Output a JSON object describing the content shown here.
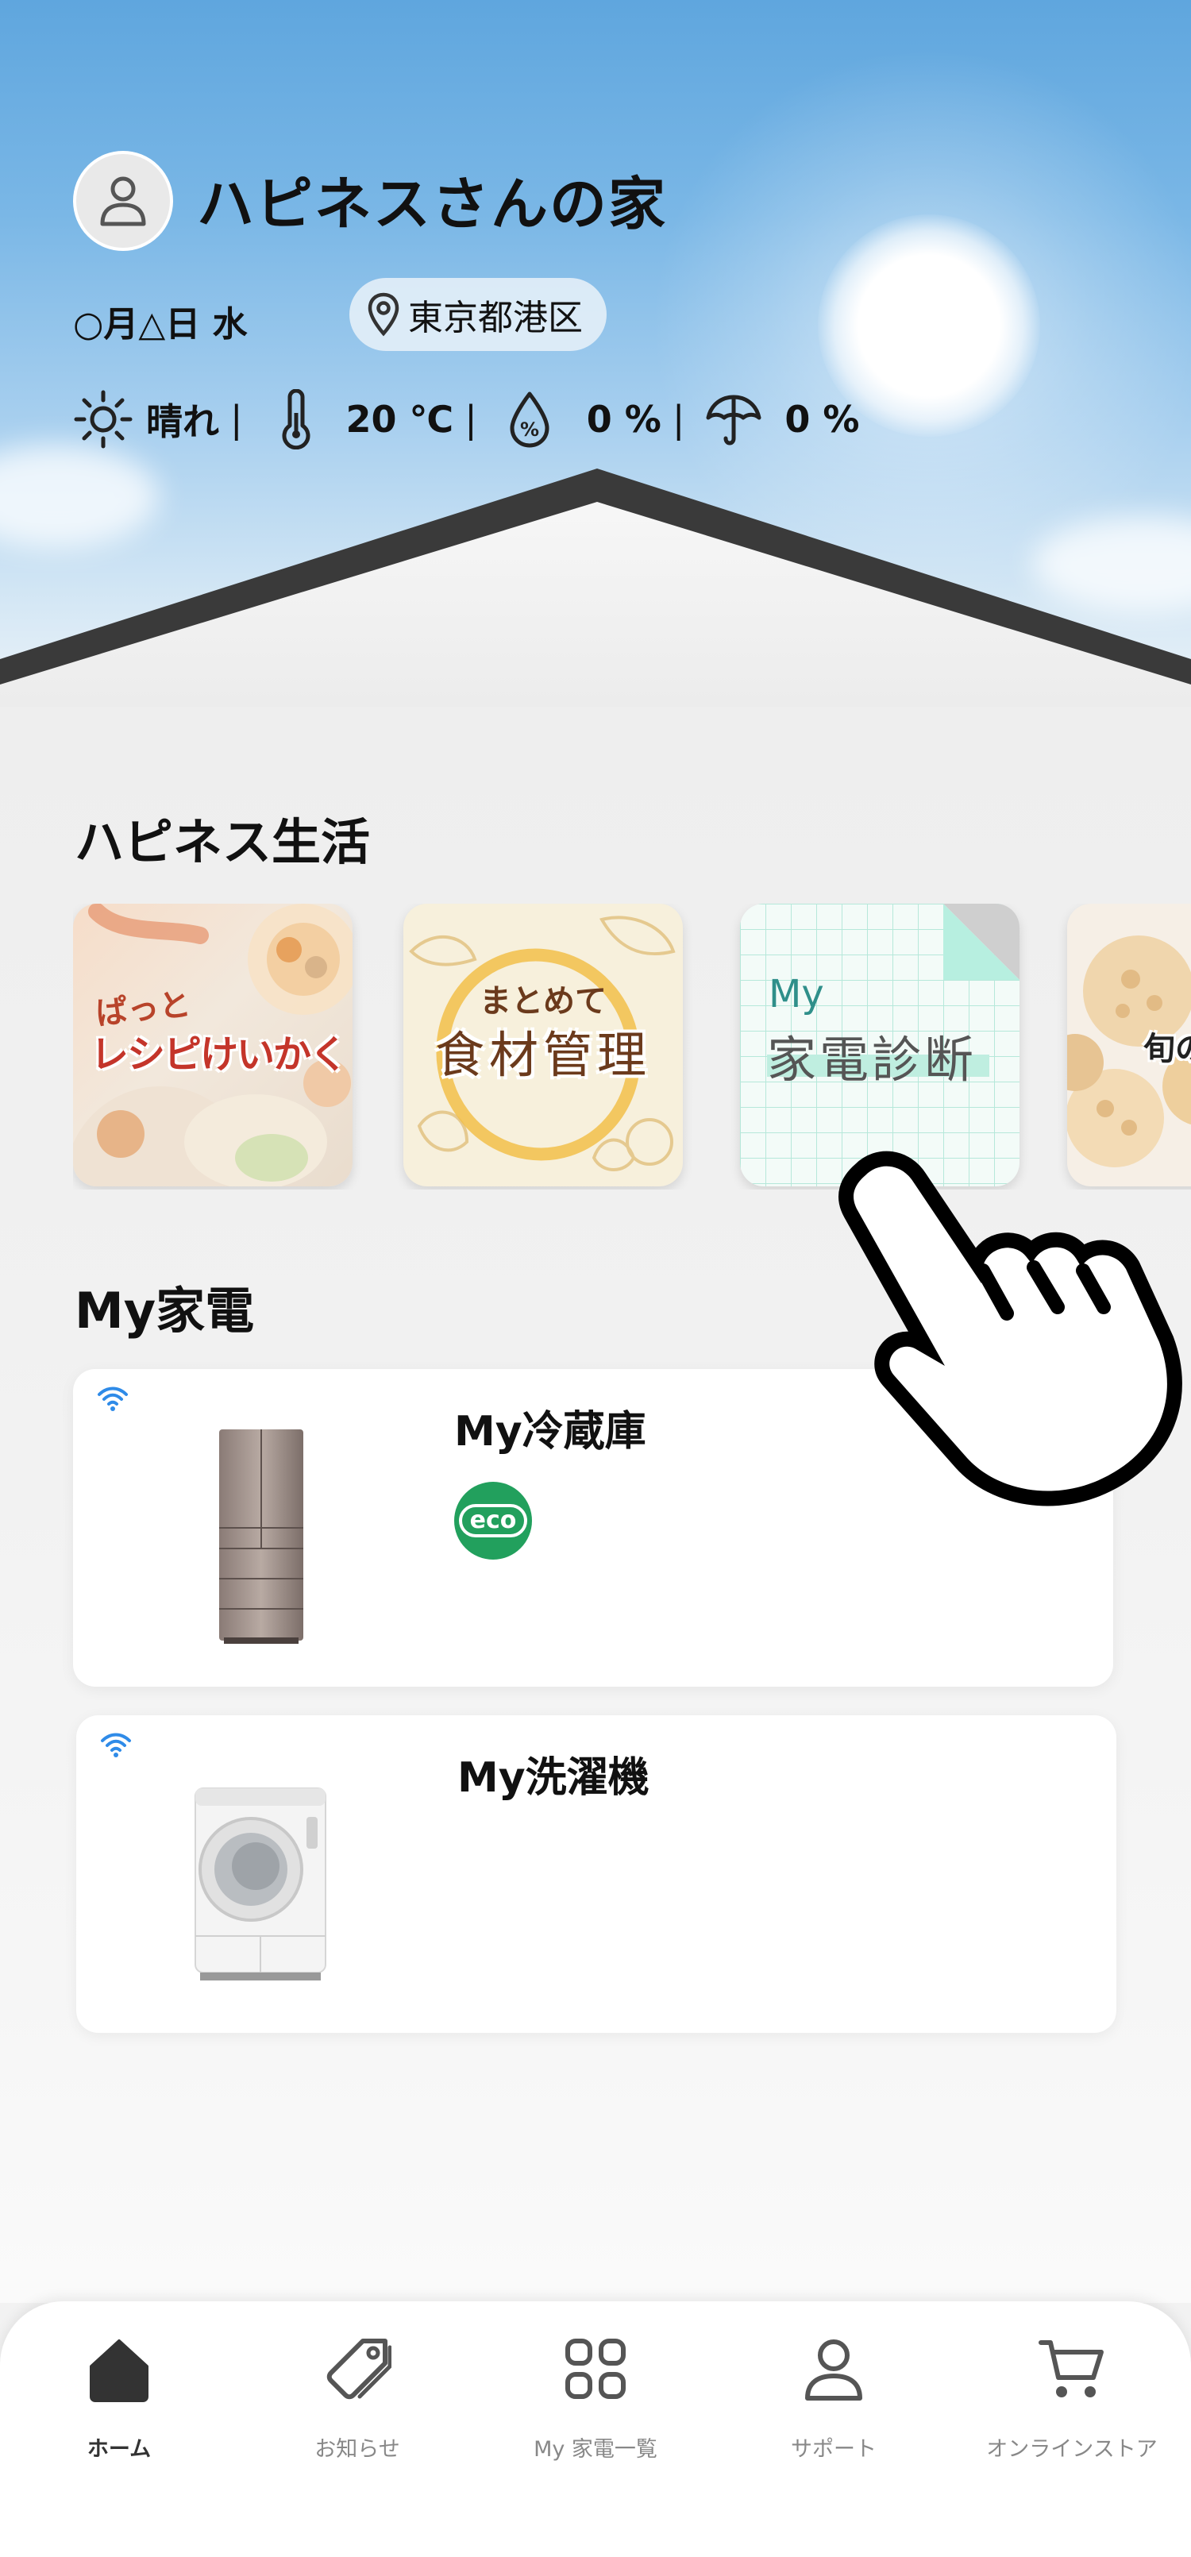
{
  "header": {
    "home_title": "ハピネスさんの家",
    "date": "○月△日  水",
    "location": "東京都港区",
    "avatar_icon": "user-icon"
  },
  "weather": {
    "condition": "晴れ",
    "temperature": "20 ℃",
    "humidity": "0 %",
    "rain_chance": "0 %",
    "icons": [
      "sun-icon",
      "thermometer-icon",
      "humidity-icon",
      "umbrella-icon"
    ]
  },
  "happiness": {
    "section_title": "ハピネス生活",
    "cards": [
      {
        "line1": "ぱっと",
        "line2": "レシピけいかく"
      },
      {
        "line1": "まとめて",
        "line2": "食材管理"
      },
      {
        "line1": "My",
        "line2": "家電診断"
      },
      {
        "line1": "旬の"
      }
    ]
  },
  "my_appliances": {
    "section_title": "My家電",
    "devices": [
      {
        "name": "My冷蔵庫",
        "badge": "eco"
      },
      {
        "name": "My洗濯機"
      }
    ]
  },
  "nav": {
    "items": [
      {
        "label": "ホーム",
        "icon": "home-icon"
      },
      {
        "label": "お知らせ",
        "icon": "tag-icon"
      },
      {
        "label": "My 家電一覧",
        "icon": "grid-icon"
      },
      {
        "label": "サポート",
        "icon": "person-icon"
      },
      {
        "label": "オンラインストア",
        "icon": "cart-icon"
      }
    ]
  },
  "colors": {
    "sky": "#7ab7e6",
    "roof": "#3a3a3a",
    "eco_green": "#22a05d",
    "wifi_blue": "#2f8be8",
    "text": "#111111",
    "nav_inactive": "#888888"
  }
}
